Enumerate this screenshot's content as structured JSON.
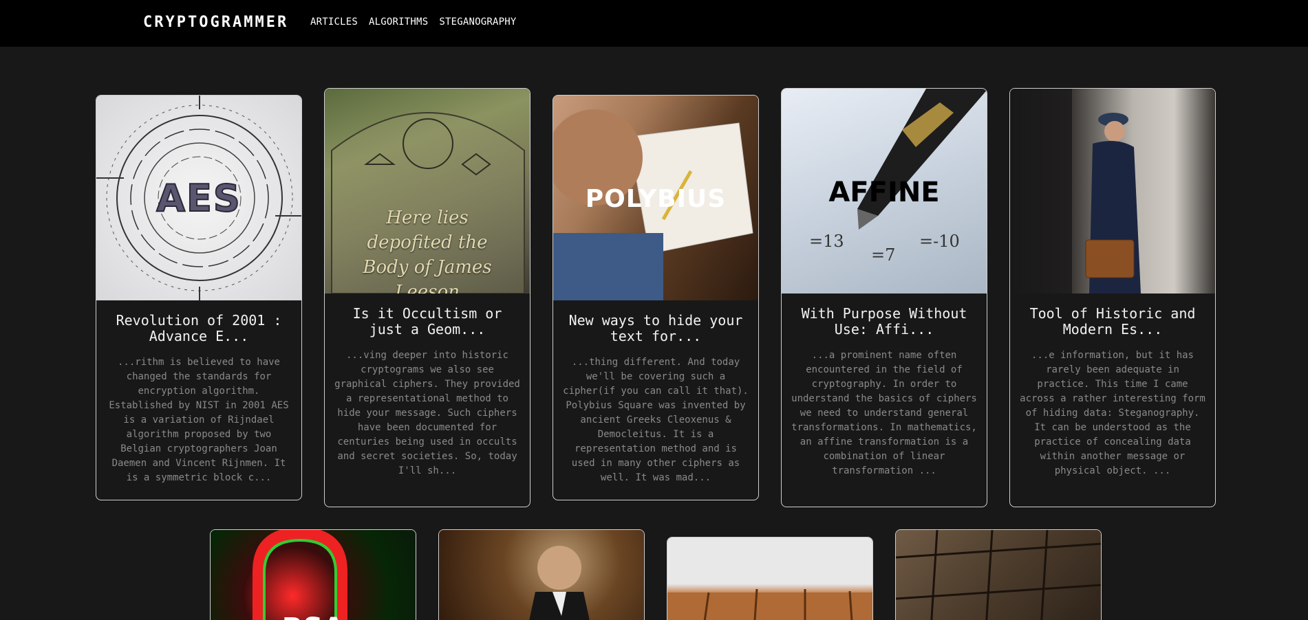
{
  "header": {
    "brand": "CRYPTOGRAMMER",
    "nav": [
      "ARTICLES",
      "ALGORITHMS",
      "STEGANOGRAPHY"
    ]
  },
  "cards": [
    {
      "image_text": "AES",
      "title": "Revolution of 2001 : Advance E...",
      "excerpt": "...rithm is believed to have changed the standards for encryption algorithm. Established by NIST in 2001 AES is a variation of Rijndael algorithm proposed by two Belgian cryptographers Joan Daemen and Vincent Rijnmen. It is a symmetric block c..."
    },
    {
      "image_text": "Here lies depofited the Body of James Leeson",
      "title": "Is it Occultism or just a Geom...",
      "excerpt": "...ving deeper into historic cryptograms we also see graphical ciphers. They provided a representational method to hide your message. Such ciphers have been documented for centuries being used in occults and secret societies. So, today I'll sh..."
    },
    {
      "image_text": "POLYBIUS",
      "title": "New ways to hide your text for...",
      "excerpt": "...thing different. And today we'll be covering such a cipher(if you can call it that). Polybius Square was invented by ancient Greeks Cleoxenus & Democleitus. It is a representation method and is used in many other ciphers as well. It was mad..."
    },
    {
      "image_text": "AFFINE",
      "title": "With Purpose Without Use: Affi...",
      "excerpt": "...a prominent name often encountered in the field of cryptography. In order to understand the basics of ciphers we need to understand general transformations. In mathematics, an affine transformation is a combination of linear transformation ..."
    },
    {
      "image_text": "",
      "title": "Tool of Historic and Modern Es...",
      "excerpt": "...e information, but it has rarely been adequate in practice. This time I came across a rather interesting form of hiding data: Steganography. It can be understood as the practice of concealing data within another message or physical object. ..."
    }
  ],
  "bottom_cards": [
    {
      "image_text": "RSA"
    },
    {
      "image_text": ""
    },
    {
      "image_text": ""
    },
    {
      "image_text": ""
    }
  ]
}
